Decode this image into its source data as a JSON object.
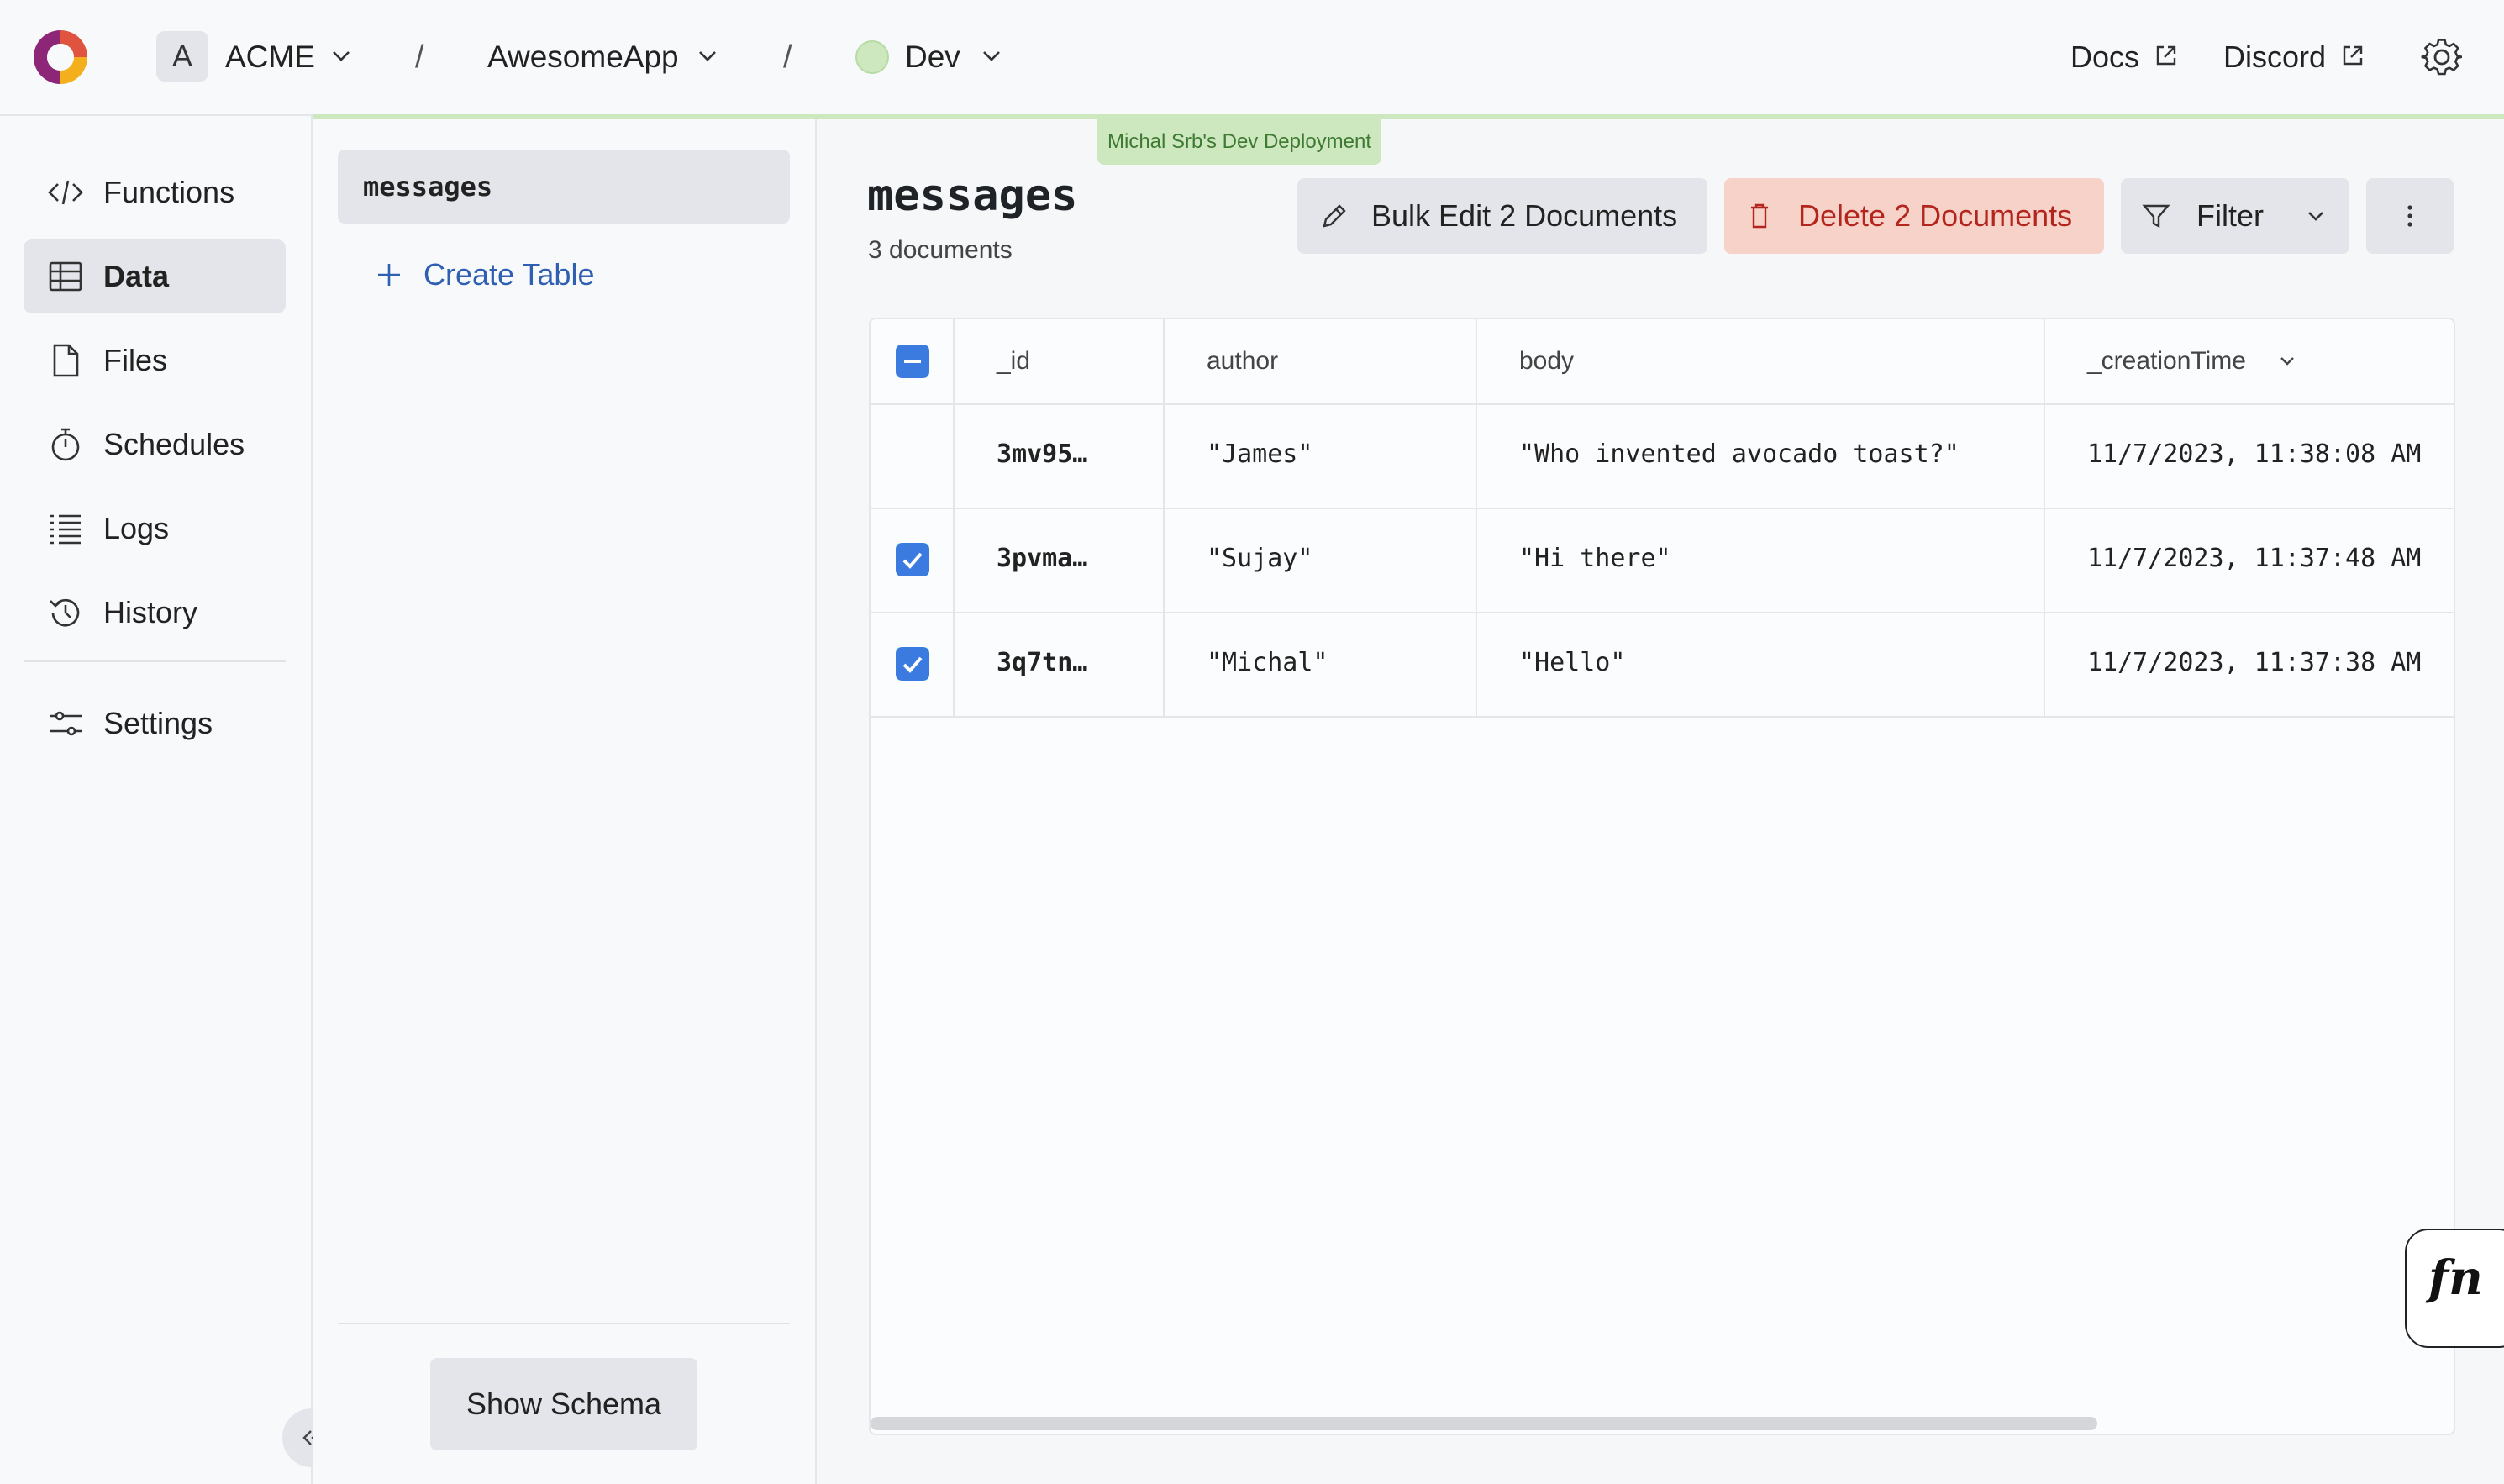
{
  "header": {
    "team": {
      "avatar_letter": "A",
      "name": "ACME"
    },
    "project": {
      "name": "AwesomeApp"
    },
    "deployment": {
      "name": "Dev"
    },
    "separator": "/",
    "links": {
      "docs": "Docs",
      "discord": "Discord"
    },
    "deployment_badge": "Michal Srb's Dev Deployment"
  },
  "sidebar": {
    "items": [
      {
        "label": "Functions",
        "icon": "code-icon"
      },
      {
        "label": "Data",
        "icon": "table-icon",
        "active": true
      },
      {
        "label": "Files",
        "icon": "file-icon"
      },
      {
        "label": "Schedules",
        "icon": "stopwatch-icon"
      },
      {
        "label": "Logs",
        "icon": "list-icon"
      },
      {
        "label": "History",
        "icon": "history-icon"
      }
    ],
    "settings": {
      "label": "Settings",
      "icon": "sliders-icon"
    }
  },
  "tables_panel": {
    "tables": [
      "messages"
    ],
    "create_table_label": "Create Table",
    "show_schema_label": "Show Schema"
  },
  "main": {
    "table_name": "messages",
    "document_count": "3 documents",
    "toolbar": {
      "bulk_edit_label": "Bulk Edit 2 Documents",
      "delete_label": "Delete 2 Documents",
      "filter_label": "Filter"
    },
    "columns": [
      "_id",
      "author",
      "body",
      "_creationTime"
    ],
    "rows": [
      {
        "checked": false,
        "id": "3mv95…",
        "author": "\"James\"",
        "body": "\"Who invented avocado toast?\"",
        "creation_time": "11/7/2023, 11:38:08 AM"
      },
      {
        "checked": true,
        "id": "3pvma…",
        "author": "\"Sujay\"",
        "body": "\"Hi there\"",
        "creation_time": "11/7/2023, 11:37:48 AM"
      },
      {
        "checked": true,
        "id": "3q7tn…",
        "author": "\"Michal\"",
        "body": "\"Hello\"",
        "creation_time": "11/7/2023, 11:37:38 AM"
      }
    ],
    "select_all_state": "indeterminate"
  },
  "fn_button_label": "fn",
  "colors": {
    "accent_blue": "#3b7be0",
    "delete_bg": "#f7d2c9",
    "delete_text": "#b3261e",
    "dev_green": "#cde7bf",
    "link_blue": "#2f5fb0"
  }
}
